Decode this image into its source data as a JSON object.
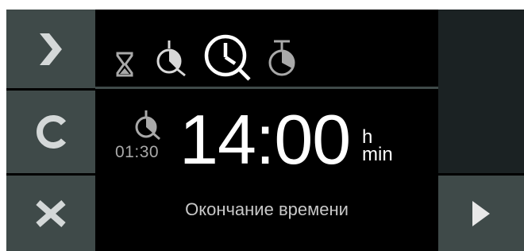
{
  "colors": {
    "button_bg": "#3f4a49",
    "panel_dark": "#1b2223",
    "screen_bg": "#000000",
    "icon_white": "#ffffff",
    "icon_gray": "#a9a9a9",
    "text_gray": "#c8c8c8"
  },
  "left_buttons": [
    {
      "icon": "chevron-right-icon",
      "action": "forward"
    },
    {
      "icon": "clear-c-icon",
      "action": "clear"
    },
    {
      "icon": "close-x-icon",
      "action": "cancel"
    }
  ],
  "modes": [
    {
      "icon": "hourglass-icon",
      "selected": false
    },
    {
      "icon": "duration-clock-icon",
      "selected": false
    },
    {
      "icon": "end-time-clock-icon",
      "selected": true
    },
    {
      "icon": "stopwatch-icon",
      "selected": false
    }
  ],
  "main": {
    "duration_value": "01:30",
    "time_value": "14:00",
    "unit_hours": "h",
    "unit_minutes": "min",
    "status_label": "Окончание времени"
  },
  "right_buttons": [
    {
      "icon": "play-icon",
      "action": "start"
    }
  ]
}
